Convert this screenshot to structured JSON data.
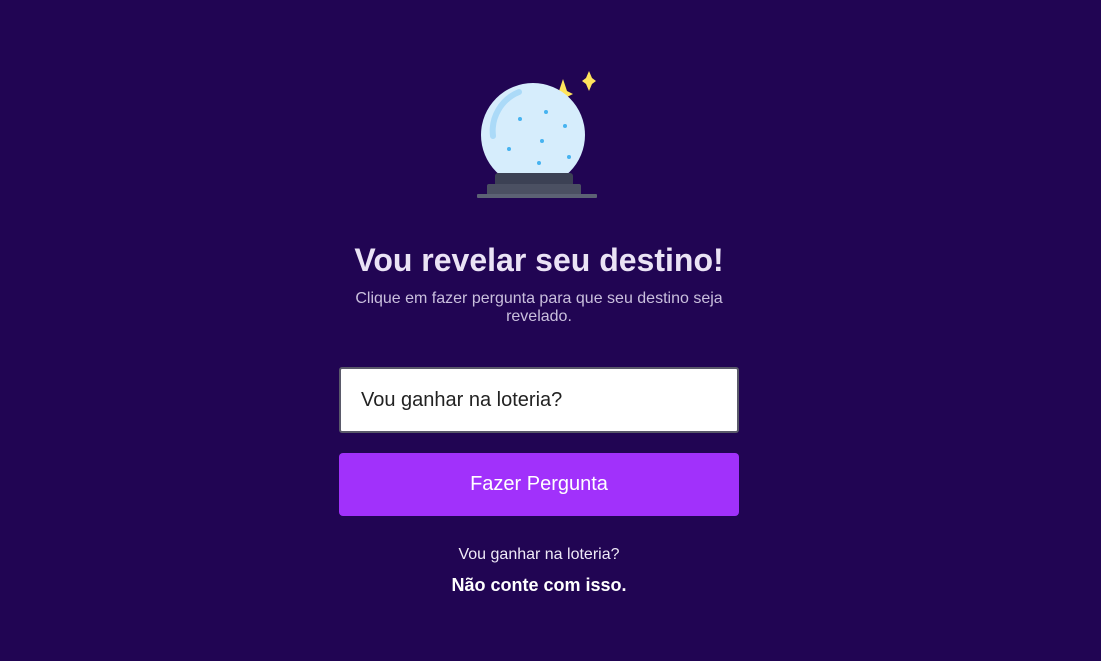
{
  "header": {
    "title": "Vou revelar seu destino!",
    "subtitle": "Clique em fazer pergunta para que seu destino seja revelado.",
    "illustration_icon": "crystal-ball-icon"
  },
  "form": {
    "question_value": "Vou ganhar na loteria?",
    "ask_button_label": "Fazer Pergunta"
  },
  "result": {
    "question": "Vou ganhar na loteria?",
    "answer": "Não conte com isso."
  },
  "colors": {
    "background": "#210553",
    "accent": "#A131FB",
    "sparkle": "#FFE45C"
  }
}
